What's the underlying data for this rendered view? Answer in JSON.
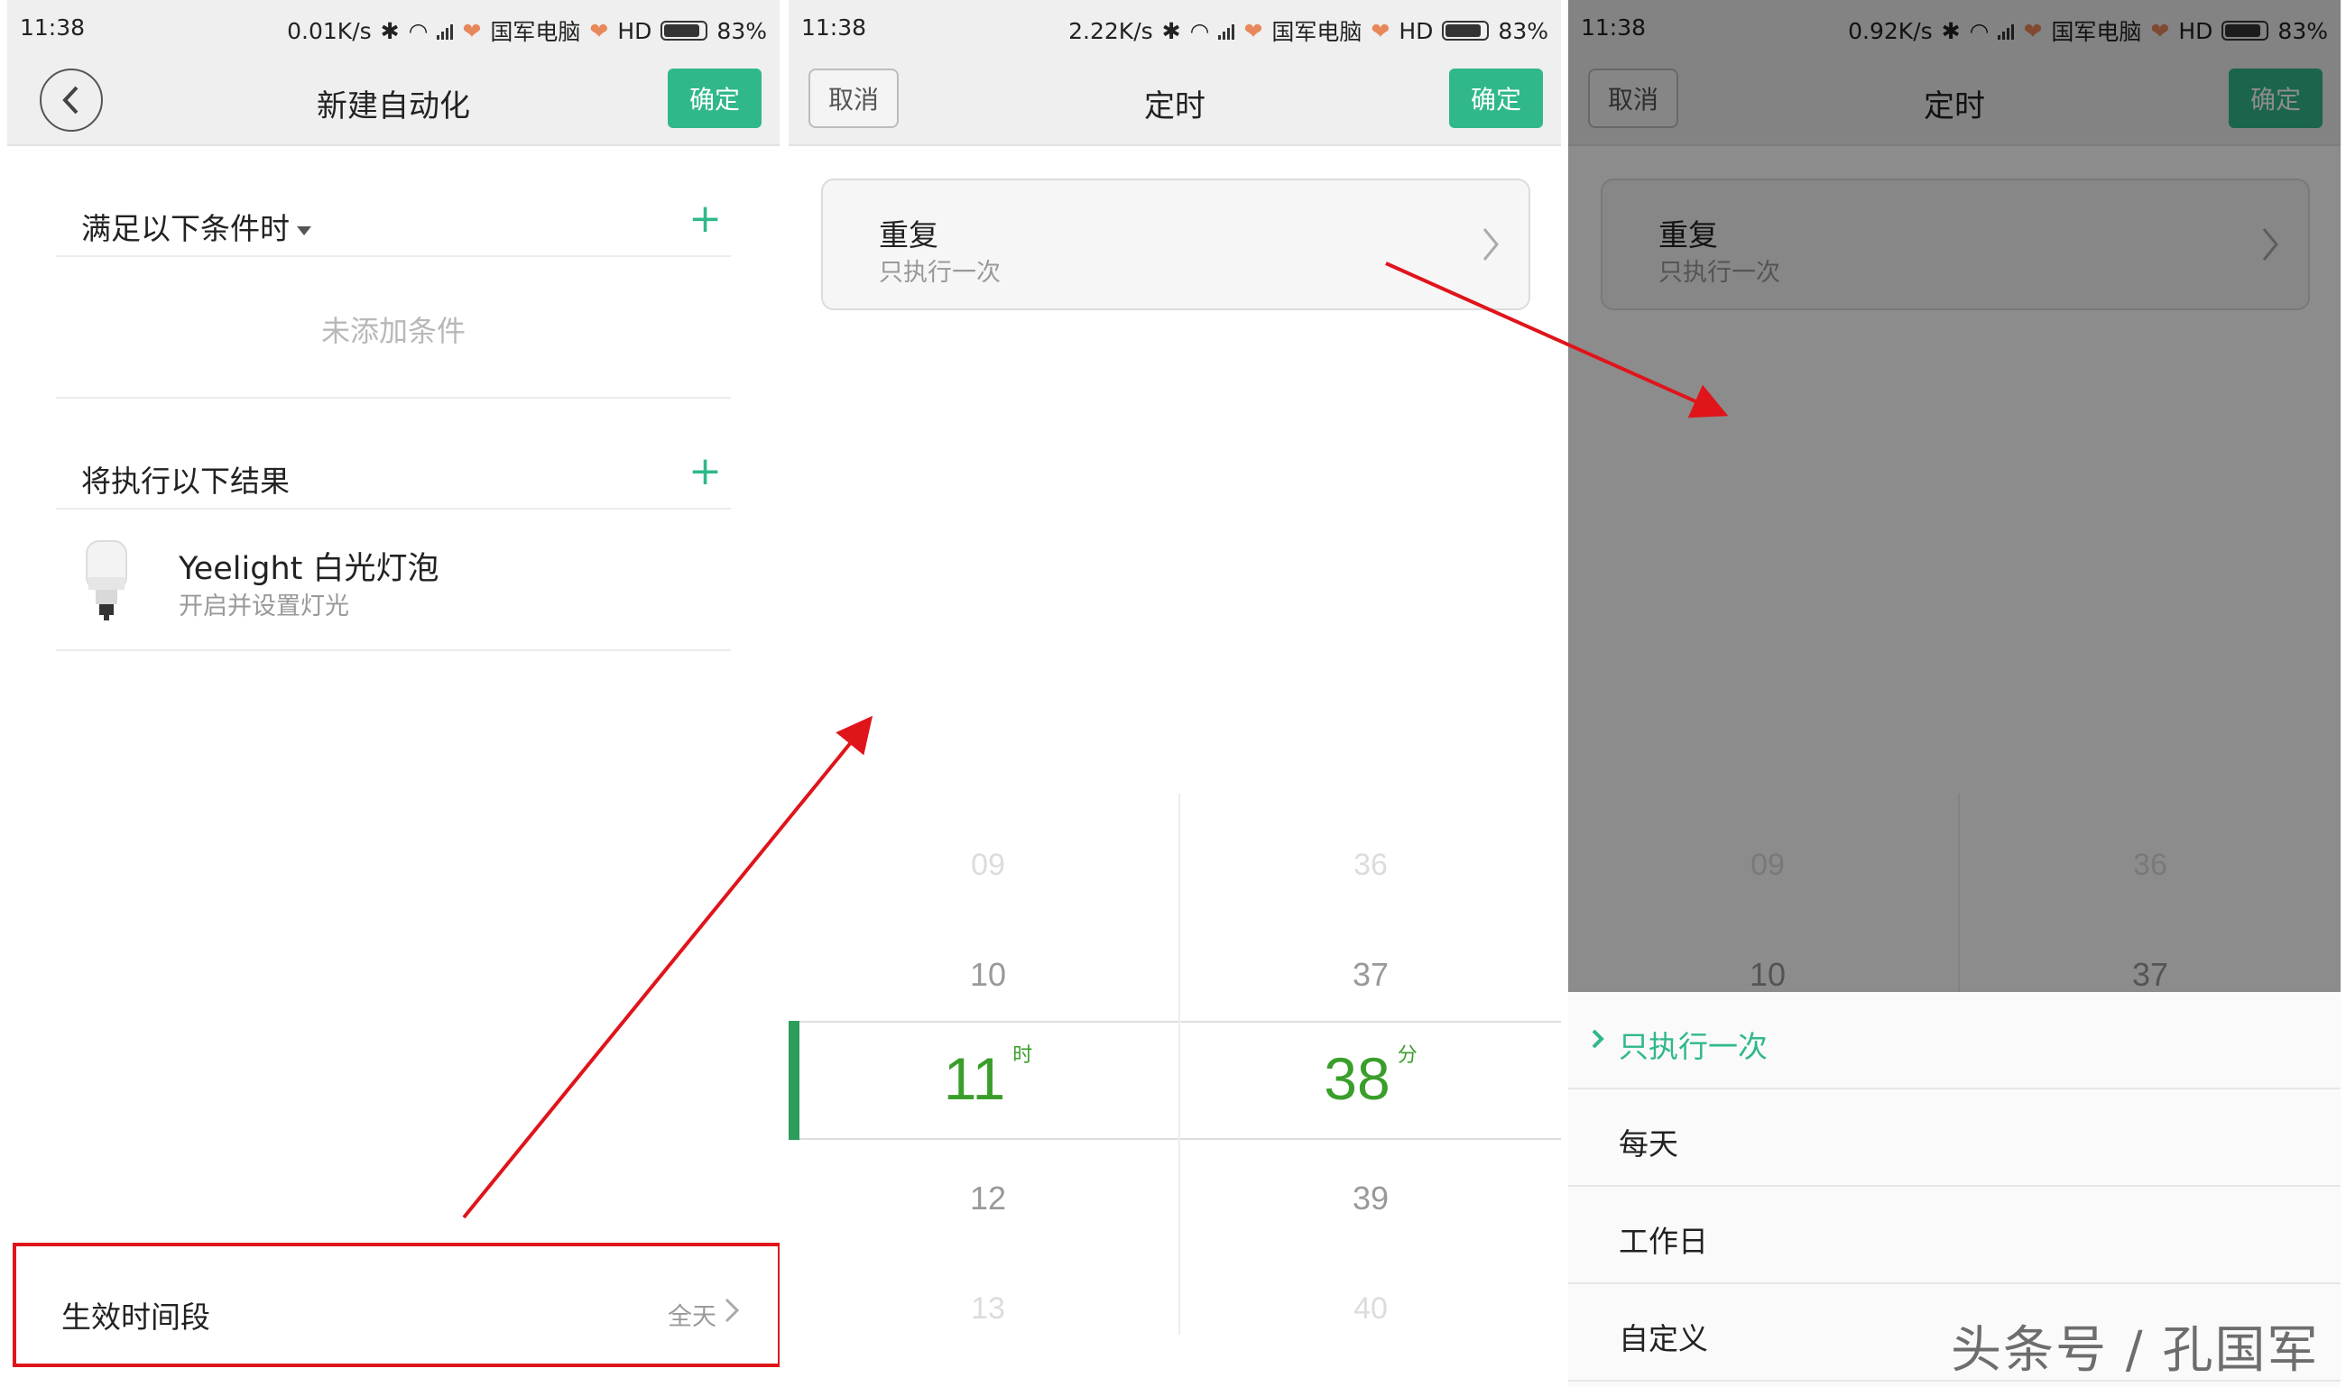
{
  "panel1": {
    "status": {
      "time": "11:38",
      "speed": "0.01K/s",
      "carrier": "国军电脑",
      "hd": "HD",
      "battery": "83%"
    },
    "title": "新建自动化",
    "confirm_label": "确定",
    "condition_header": "满足以下条件时",
    "empty_condition": "未添加条件",
    "result_header": "将执行以下结果",
    "device": {
      "name": "Yeelight 白光灯泡",
      "action": "开启并设置灯光"
    },
    "effective_period": {
      "label": "生效时间段",
      "value": "全天"
    }
  },
  "panel2": {
    "status": {
      "time": "11:38",
      "speed": "2.22K/s",
      "carrier": "国军电脑",
      "hd": "HD",
      "battery": "83%"
    },
    "cancel_label": "取消",
    "title": "定时",
    "confirm_label": "确定",
    "repeat": {
      "label": "重复",
      "value": "只执行一次"
    },
    "hours": [
      "09",
      "10",
      "11",
      "12",
      "13"
    ],
    "minutes": [
      "36",
      "37",
      "38",
      "39",
      "40"
    ],
    "selected_hour": "11",
    "selected_minute": "38",
    "hour_unit": "时",
    "minute_unit": "分"
  },
  "panel3": {
    "status": {
      "time": "11:38",
      "speed": "0.92K/s",
      "carrier": "国军电脑",
      "hd": "HD",
      "battery": "83%"
    },
    "cancel_label": "取消",
    "title": "定时",
    "confirm_label": "确定",
    "repeat": {
      "label": "重复",
      "value": "只执行一次"
    },
    "hours": [
      "09",
      "10"
    ],
    "minutes": [
      "36",
      "37"
    ],
    "options": [
      {
        "label": "只执行一次",
        "selected": true
      },
      {
        "label": "每天",
        "selected": false
      },
      {
        "label": "工作日",
        "selected": false
      },
      {
        "label": "自定义",
        "selected": false
      }
    ]
  },
  "watermark": "头条号 / 孔国军",
  "colors": {
    "accent": "#30b88a",
    "picker_selected": "#3a9e2a",
    "annotation_red": "#e0141b"
  }
}
